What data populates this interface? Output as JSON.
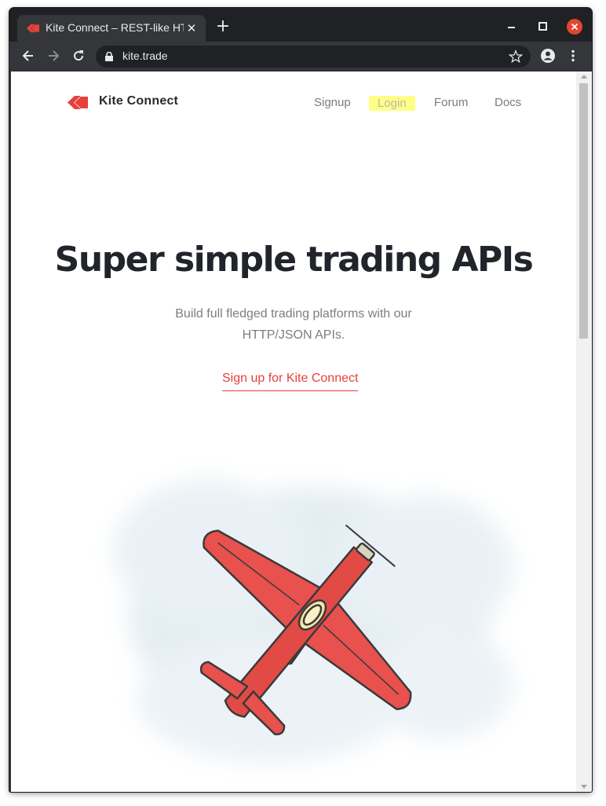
{
  "browser": {
    "tab_title": "Kite Connect – REST-like HTTP API",
    "tab_close": "✕",
    "new_tab": "+",
    "url": "kite.trade"
  },
  "site": {
    "brand": "Kite Connect",
    "nav": [
      "Signup",
      "Login",
      "Forum",
      "Docs"
    ],
    "hero_title": "Super simple trading APIs",
    "hero_subtitle": "Build full fledged trading platforms with our HTTP/JSON APIs.",
    "cta": "Sign up for Kite Connect"
  },
  "colors": {
    "brand_red": "#e8403a",
    "login_highlight": "#ffff86",
    "plane_red": "#e8514d",
    "cloud": "#dde8ef"
  },
  "icons": [
    "kite-logo-icon",
    "back-arrow-icon",
    "forward-arrow-icon",
    "reload-icon",
    "lock-icon",
    "star-icon",
    "account-icon",
    "menu-dots-icon",
    "minimize-icon",
    "maximize-icon",
    "close-window-icon",
    "airplane-illustration"
  ]
}
